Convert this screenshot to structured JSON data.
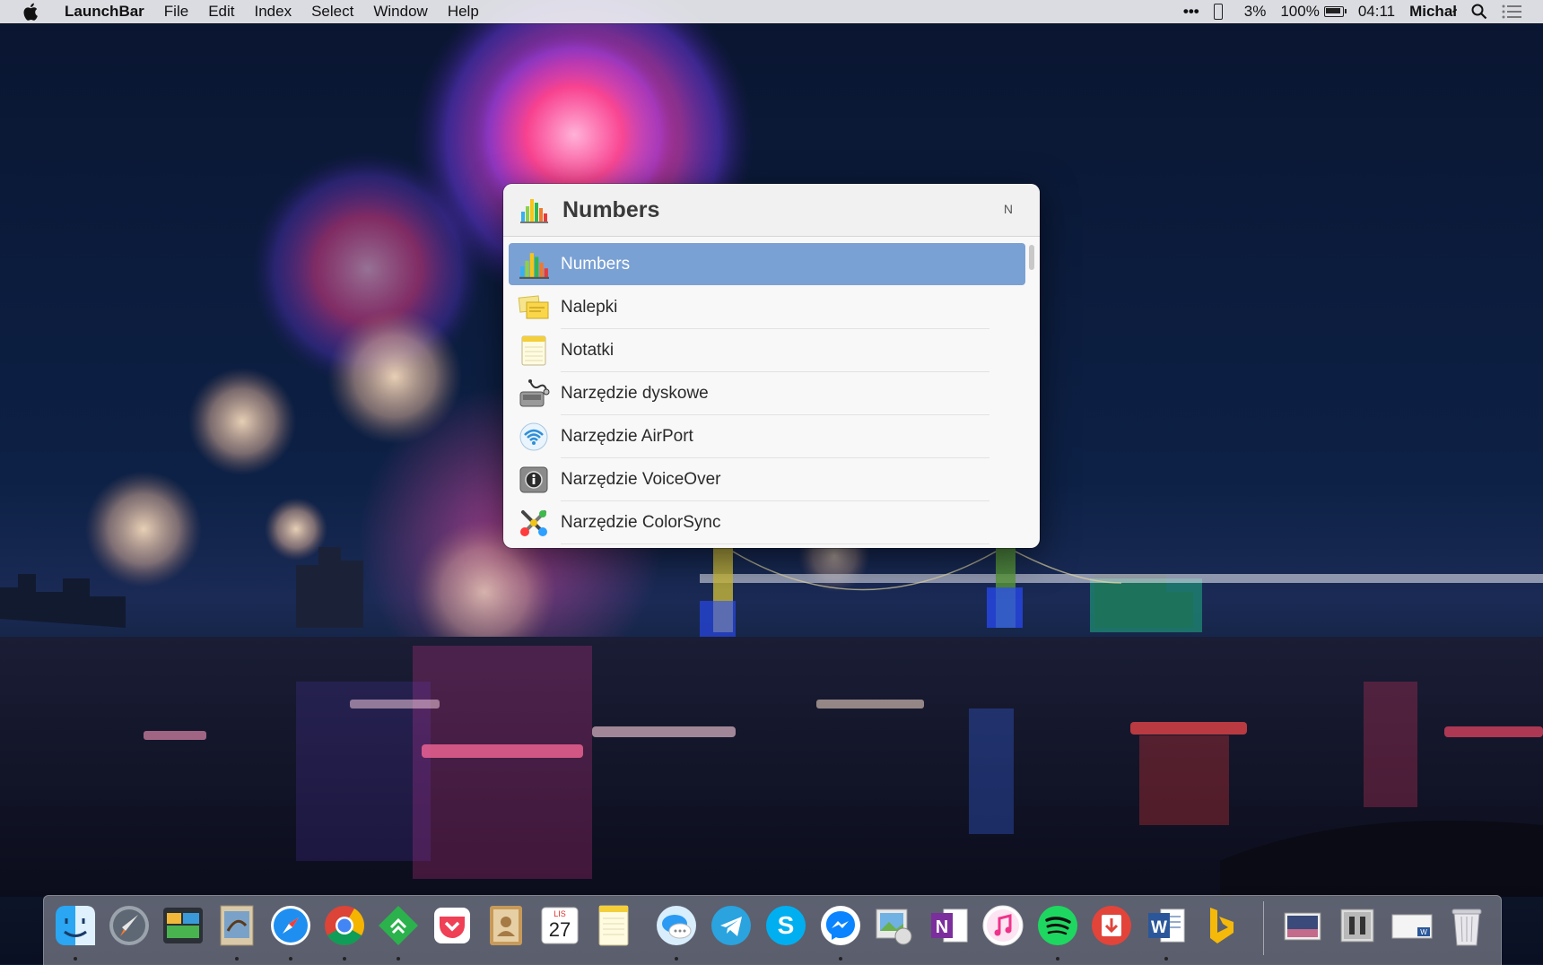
{
  "menubar": {
    "app_name": "LaunchBar",
    "menus": [
      "File",
      "Edit",
      "Index",
      "Select",
      "Window",
      "Help"
    ],
    "status": {
      "more": "•••",
      "phone_battery": "3%",
      "battery": "100%",
      "clock": "04:11",
      "user": "Michał"
    }
  },
  "launchbar": {
    "title": "Numbers",
    "abbrev_key": "N",
    "results": [
      {
        "label": "Numbers",
        "icon": "numbers-icon",
        "selected": true
      },
      {
        "label": "Nalepki",
        "icon": "stickies-icon",
        "selected": false
      },
      {
        "label": "Notatki",
        "icon": "notes-icon",
        "selected": false
      },
      {
        "label": "Narzędzie dyskowe",
        "icon": "disk-utility-icon",
        "selected": false
      },
      {
        "label": "Narzędzie AirPort",
        "icon": "airport-utility-icon",
        "selected": false
      },
      {
        "label": "Narzędzie VoiceOver",
        "icon": "voiceover-utility-icon",
        "selected": false
      },
      {
        "label": "Narzędzie ColorSync",
        "icon": "colorsync-utility-icon",
        "selected": false
      }
    ]
  },
  "dock": {
    "calendar_month": "LIS",
    "calendar_day": "27",
    "apps": [
      {
        "name": "finder",
        "running": true
      },
      {
        "name": "launchpad",
        "running": false
      },
      {
        "name": "photo-app",
        "running": false
      },
      {
        "name": "mail",
        "running": true
      },
      {
        "name": "safari",
        "running": true
      },
      {
        "name": "chrome",
        "running": true
      },
      {
        "name": "feedly",
        "running": true
      },
      {
        "name": "pocket",
        "running": false
      },
      {
        "name": "contacts",
        "running": false
      },
      {
        "name": "calendar",
        "running": false
      },
      {
        "name": "notes",
        "running": false
      },
      {
        "name": "messages",
        "running": true
      },
      {
        "name": "telegram",
        "running": false
      },
      {
        "name": "skype",
        "running": false
      },
      {
        "name": "messenger",
        "running": true
      },
      {
        "name": "preview",
        "running": false
      },
      {
        "name": "onenote",
        "running": false
      },
      {
        "name": "itunes",
        "running": false
      },
      {
        "name": "spotify",
        "running": true
      },
      {
        "name": "transmit",
        "running": false
      },
      {
        "name": "word",
        "running": true
      },
      {
        "name": "bing-app",
        "running": false
      },
      {
        "name": "stack-photos",
        "running": false
      },
      {
        "name": "stack-movies",
        "running": false
      },
      {
        "name": "stack-documents",
        "running": false
      },
      {
        "name": "trash",
        "running": false
      }
    ]
  }
}
